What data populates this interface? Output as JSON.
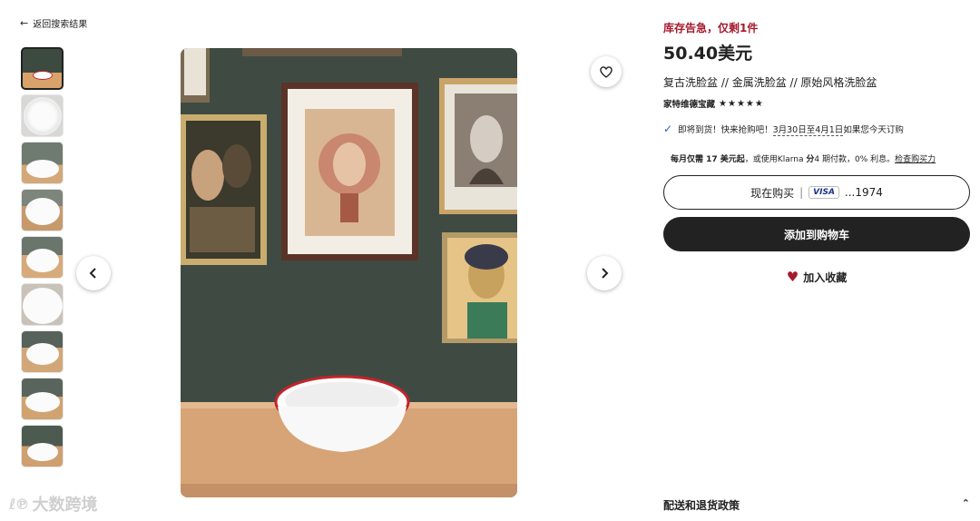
{
  "nav": {
    "back_label": "返回搜索结果"
  },
  "watermark": {
    "logo": "ℓ℗",
    "text": "大数跨境"
  },
  "product": {
    "stock_alert": "库存告急，仅剩1件",
    "price": "50.40美元",
    "title": "复古洗脸盆 // 金属洗脸盆 // 原始风格洗脸盆",
    "shop_name": "家特维德宝藏",
    "rating_stars": "★★★★★"
  },
  "delivery": {
    "prefix": "即将到货！快来抢购吧！",
    "dates": "3月30日至4月1日",
    "suffix": "如果您今天订购"
  },
  "klarna": {
    "bold_text": "每月仅需 17 美元起",
    "mid_text": "，或使用Klarna ",
    "bold2": "分",
    "rest": "4 期付款，0% 利息。",
    "link": "检查购买力"
  },
  "actions": {
    "buy_now_label": "现在购买",
    "card_brand": "VISA",
    "card_digits": "...1974",
    "add_to_cart_label": "添加到购物车",
    "favorite_label": "加入收藏"
  },
  "policy": {
    "label": "配送和退货政策"
  },
  "colors": {
    "accent_red": "#a61a2e",
    "dark": "#222222",
    "visa_blue": "#1a2f8a"
  },
  "icons": {
    "back": "arrow-left-icon",
    "prev": "chevron-left-icon",
    "next": "chevron-right-icon",
    "favorite": "heart-outline-icon",
    "check": "check-icon",
    "heart_filled": "heart-filled-icon",
    "policy": "chevron-up-icon"
  }
}
